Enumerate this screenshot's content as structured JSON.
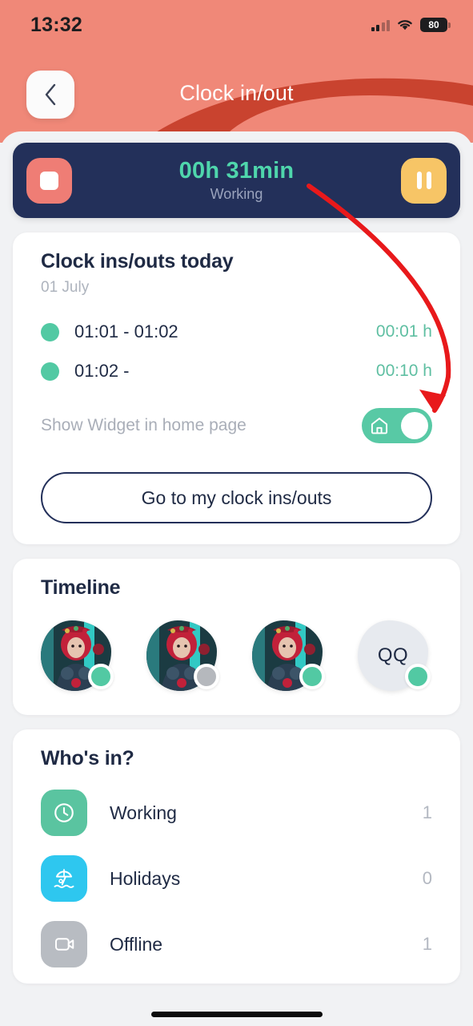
{
  "status_bar": {
    "time": "13:32",
    "battery_level": "80",
    "signal_icon": "cellular-signal-icon",
    "wifi_icon": "wifi-icon",
    "battery_icon": "battery-icon"
  },
  "header": {
    "title": "Clock in/out",
    "back_icon": "chevron-left-icon",
    "bg_color": "#c9432f",
    "blob_color": "#f08878"
  },
  "timer": {
    "value": "00h 31min",
    "status": "Working",
    "stop_icon": "stop-icon",
    "pause_icon": "pause-icon",
    "card_color": "#23305a",
    "value_color": "#4fd6ac",
    "stop_color": "#ef7d75",
    "pause_color": "#f7c566"
  },
  "clock_card": {
    "title": "Clock ins/outs today",
    "date": "01 July",
    "entries": [
      {
        "range": "01:01 - 01:02",
        "duration": "00:01 h",
        "dot": "status-dot-green"
      },
      {
        "range": "01:02 -",
        "duration": "00:10 h",
        "dot": "status-dot-green"
      }
    ],
    "widget_label": "Show Widget in home page",
    "widget_toggle_state": "on",
    "widget_toggle_icon": "home-icon",
    "go_button_label": "Go to my clock ins/outs"
  },
  "timeline": {
    "title": "Timeline",
    "avatars": [
      {
        "type": "photo",
        "initials": "",
        "status": "green"
      },
      {
        "type": "photo",
        "initials": "",
        "status": "gray"
      },
      {
        "type": "photo",
        "initials": "",
        "status": "green"
      },
      {
        "type": "initials",
        "initials": "QQ",
        "status": "green"
      }
    ],
    "status_colors": {
      "green": "#52c9a3",
      "gray": "#b5b8bd"
    }
  },
  "whos_in": {
    "title": "Who's in?",
    "rows": [
      {
        "label": "Working",
        "count": "1",
        "icon": "clock-icon",
        "color": "#5ac4a0"
      },
      {
        "label": "Holidays",
        "count": "0",
        "icon": "beach-umbrella-icon",
        "color": "#2ec7ef"
      },
      {
        "label": "Offline",
        "count": "1",
        "icon": "offline-icon",
        "color": "#b8bcc2"
      }
    ]
  },
  "annotation": {
    "arrow_color": "#e8191b",
    "arrow_from": "timer value",
    "arrow_to": "00:10 h"
  }
}
